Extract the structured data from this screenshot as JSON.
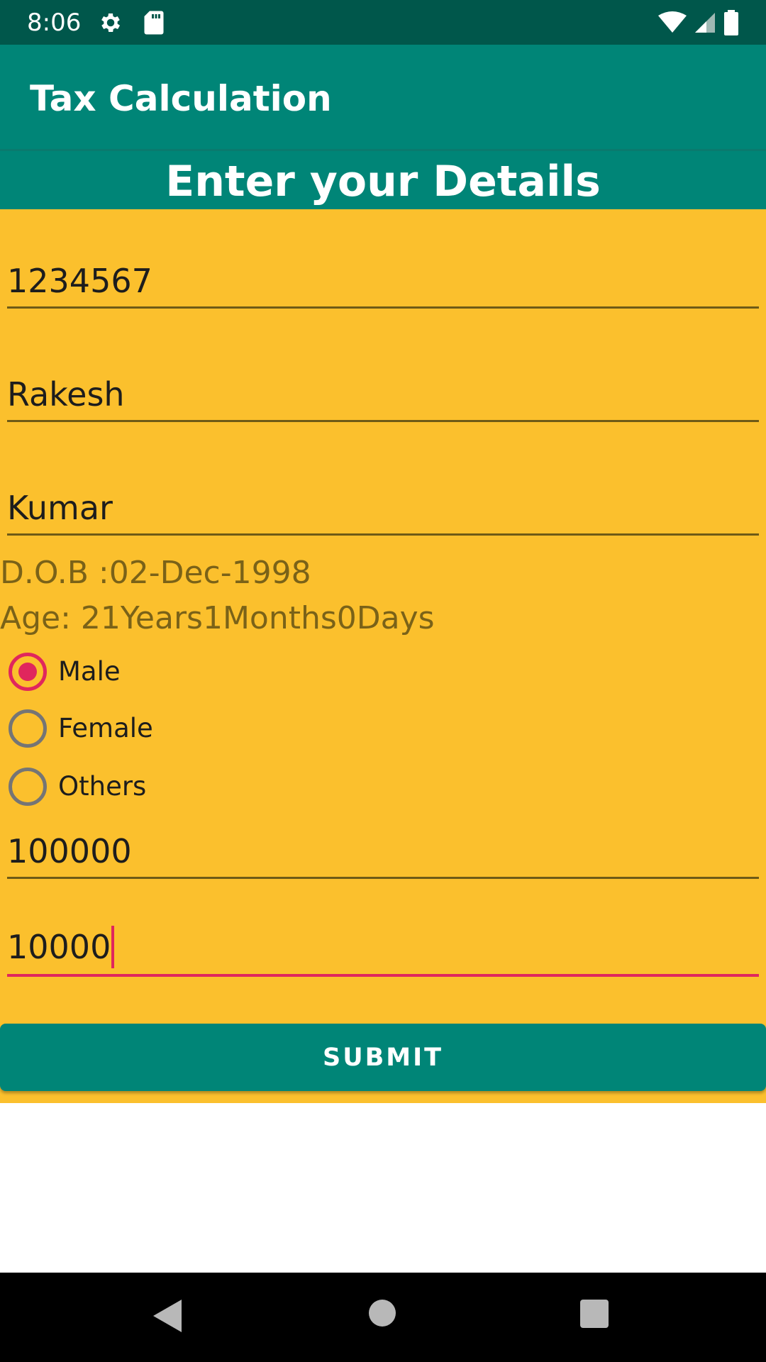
{
  "status_bar": {
    "time": "8:06",
    "left_icons": [
      "gear-icon",
      "sd-card-icon"
    ],
    "right_icons": [
      "wifi-icon",
      "cell-signal-icon",
      "battery-icon"
    ]
  },
  "app_bar": {
    "title": "Tax Calculation"
  },
  "heading": {
    "text": "Enter your Details"
  },
  "form": {
    "fields": [
      {
        "value": "1234567"
      },
      {
        "value": "Rakesh"
      },
      {
        "value": "Kumar"
      }
    ],
    "dob": "D.O.B :02-Dec-1998",
    "age": "Age: 21Years1Months0Days",
    "gender": {
      "options": [
        "Male",
        "Female",
        "Others"
      ],
      "selected": "Male"
    },
    "income": {
      "value": "100000"
    },
    "deduction": {
      "value": "10000",
      "focused": true
    },
    "submit_label": "SUBMIT"
  },
  "colors": {
    "primary": "#008577",
    "primary_dark": "#00574b",
    "accent": "#e0265d",
    "form_background": "#fbc02d"
  }
}
